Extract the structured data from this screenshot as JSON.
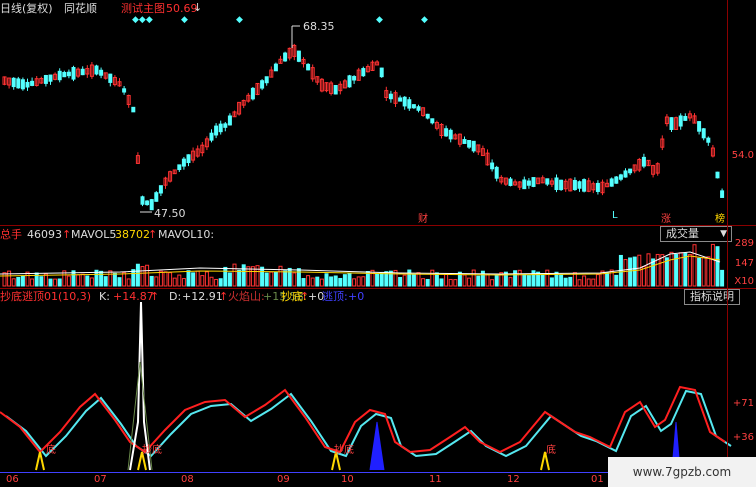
{
  "header": {
    "period_label": "日线(复权)",
    "app_name": "同花顺",
    "main_indicator_label": "测试主图",
    "main_indicator_value": "50.69"
  },
  "price_panel": {
    "high_marker": "68.35",
    "low_marker": "47.50",
    "axis_value": "54.0",
    "event_markers": [
      "财",
      "L",
      "涨",
      "榜"
    ]
  },
  "volume_panel": {
    "total_hand_label": "总手",
    "total_hand_value": "46093",
    "mavol5_label": "MAVOL5",
    "mavol5_value": "38702",
    "mavol10_label": "MAVOL10:",
    "dropdown_label": "成交量",
    "axis_values": [
      "289",
      "147",
      "X10"
    ]
  },
  "indicator_panel": {
    "name": "抄底逃顶01(10,3)",
    "k_label": "K:",
    "k_value": "+14.87",
    "d_label": "D:",
    "d_value": "+12.91",
    "fire_label": "火焰山:",
    "fire_value": "+15.58",
    "bottom_label": "抄底:",
    "bottom_value": "+0",
    "escape_label": "逃顶:",
    "escape_value": "+0",
    "help_button": "指标说明",
    "axis_values": [
      "+71",
      "+36"
    ],
    "bottom_markers": [
      "底",
      "抄底",
      "抄底",
      "底"
    ]
  },
  "x_axis": {
    "labels": [
      "06",
      "07",
      "08",
      "09",
      "10",
      "11",
      "12",
      "01"
    ]
  },
  "watermark": "www.7gpzb.com",
  "colors": {
    "up": "#ff3232",
    "down": "#54ffff",
    "k_line": "#ff2020",
    "d_line": "#55e8f0",
    "fire": "#6a8a4a",
    "accent": "#ffd700"
  }
}
